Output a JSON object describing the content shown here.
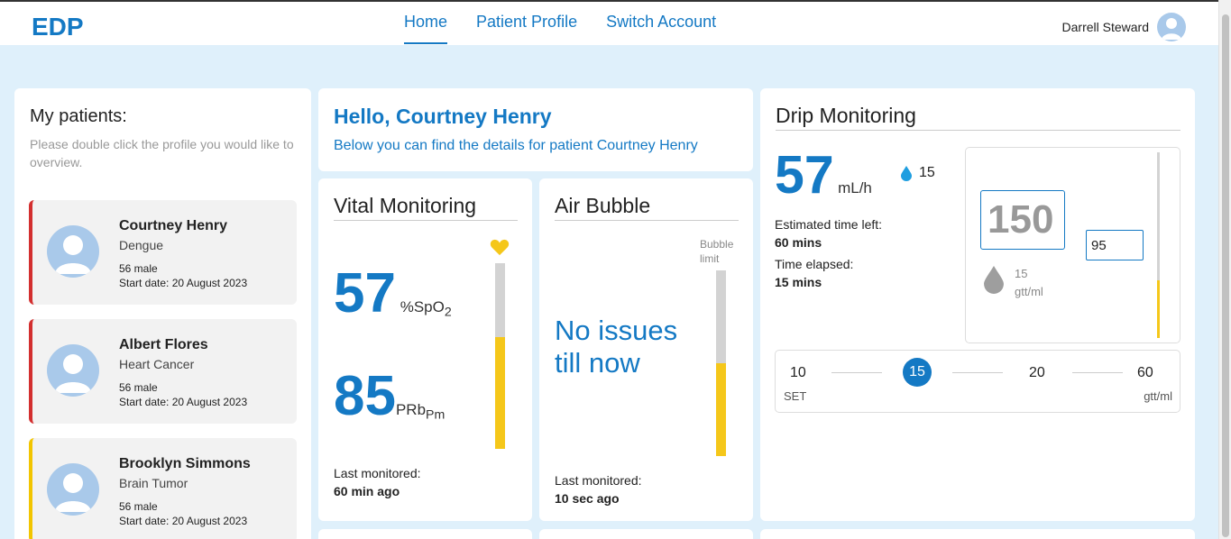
{
  "header": {
    "logo": "EDP",
    "nav": [
      {
        "label": "Home",
        "active": true
      },
      {
        "label": "Patient Profile",
        "active": false
      },
      {
        "label": "Switch Account",
        "active": false
      }
    ],
    "user_name": "Darrell Steward"
  },
  "patients": {
    "title": "My patients:",
    "hint": "Please double click the profile you would like to overview.",
    "start_label": "Start date:",
    "list": [
      {
        "name": "Courtney Henry",
        "condition": "Dengue",
        "age_sex": "56 male",
        "start_date": "20 August 2023",
        "status_color": "#d32f2f"
      },
      {
        "name": "Albert Flores",
        "condition": "Heart Cancer",
        "age_sex": "56 male",
        "start_date": "20 August 2023",
        "status_color": "#d32f2f"
      },
      {
        "name": "Brooklyn Simmons",
        "condition": "Brain Tumor",
        "age_sex": "56 male",
        "start_date": "20 August 2023",
        "status_color": "#f2c500"
      }
    ]
  },
  "greeting": {
    "title": "Hello, Courtney Henry",
    "subtitle": "Below you can find the details for patient Courtney Henry"
  },
  "vital": {
    "title": "Vital Monitoring",
    "spo2_value": "57",
    "spo2_unit": "%SpO",
    "spo2_sub": "2",
    "prbpm_value": "85",
    "prbpm_unit": "PRb",
    "prbpm_sub": "Pm",
    "bar_level": 0.6,
    "icon": "heart-icon",
    "last_label": "Last monitored:",
    "last_value": "60 min ago"
  },
  "air": {
    "title": "Air Bubble",
    "limit_label": "Bubble limit",
    "status": "No issues till now",
    "bar_level": 0.5,
    "last_label": "Last monitored:",
    "last_value": "10 sec ago"
  },
  "drip": {
    "title": "Drip Monitoring",
    "rate_value": "57",
    "rate_unit": "mL/h",
    "drop_icon": "water-drop-icon",
    "drop_count": "15",
    "est_label": "Estimated time left:",
    "est_value": "60 mins",
    "elapsed_label": "Time elapsed:",
    "elapsed_value": "15 mins",
    "volume_value": "150",
    "volume_input": "95",
    "gtt_value": "15",
    "gtt_unit": "gtt/ml",
    "gauge_level": 0.31,
    "slider": {
      "ticks": [
        "10",
        "15",
        "20",
        "60"
      ],
      "selected": "15",
      "left_label": "SET",
      "right_label": "gtt/ml"
    }
  },
  "colors": {
    "accent": "#1479c4",
    "background": "#dff0fb",
    "bar_fill": "#f5c71a",
    "alert_red": "#d32f2f",
    "alert_yellow": "#f2c500"
  }
}
